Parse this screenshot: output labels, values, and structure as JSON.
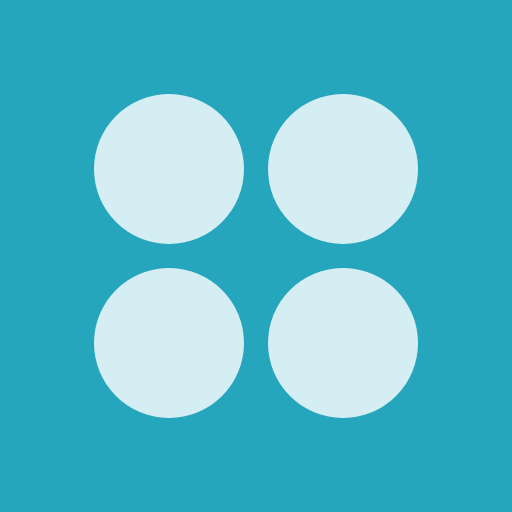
{
  "icon": {
    "name": "four-dots-grid-icon",
    "background_color": "#26A6BC",
    "dot_color": "#D5EEF3",
    "grid": {
      "rows": 2,
      "columns": 2
    }
  }
}
